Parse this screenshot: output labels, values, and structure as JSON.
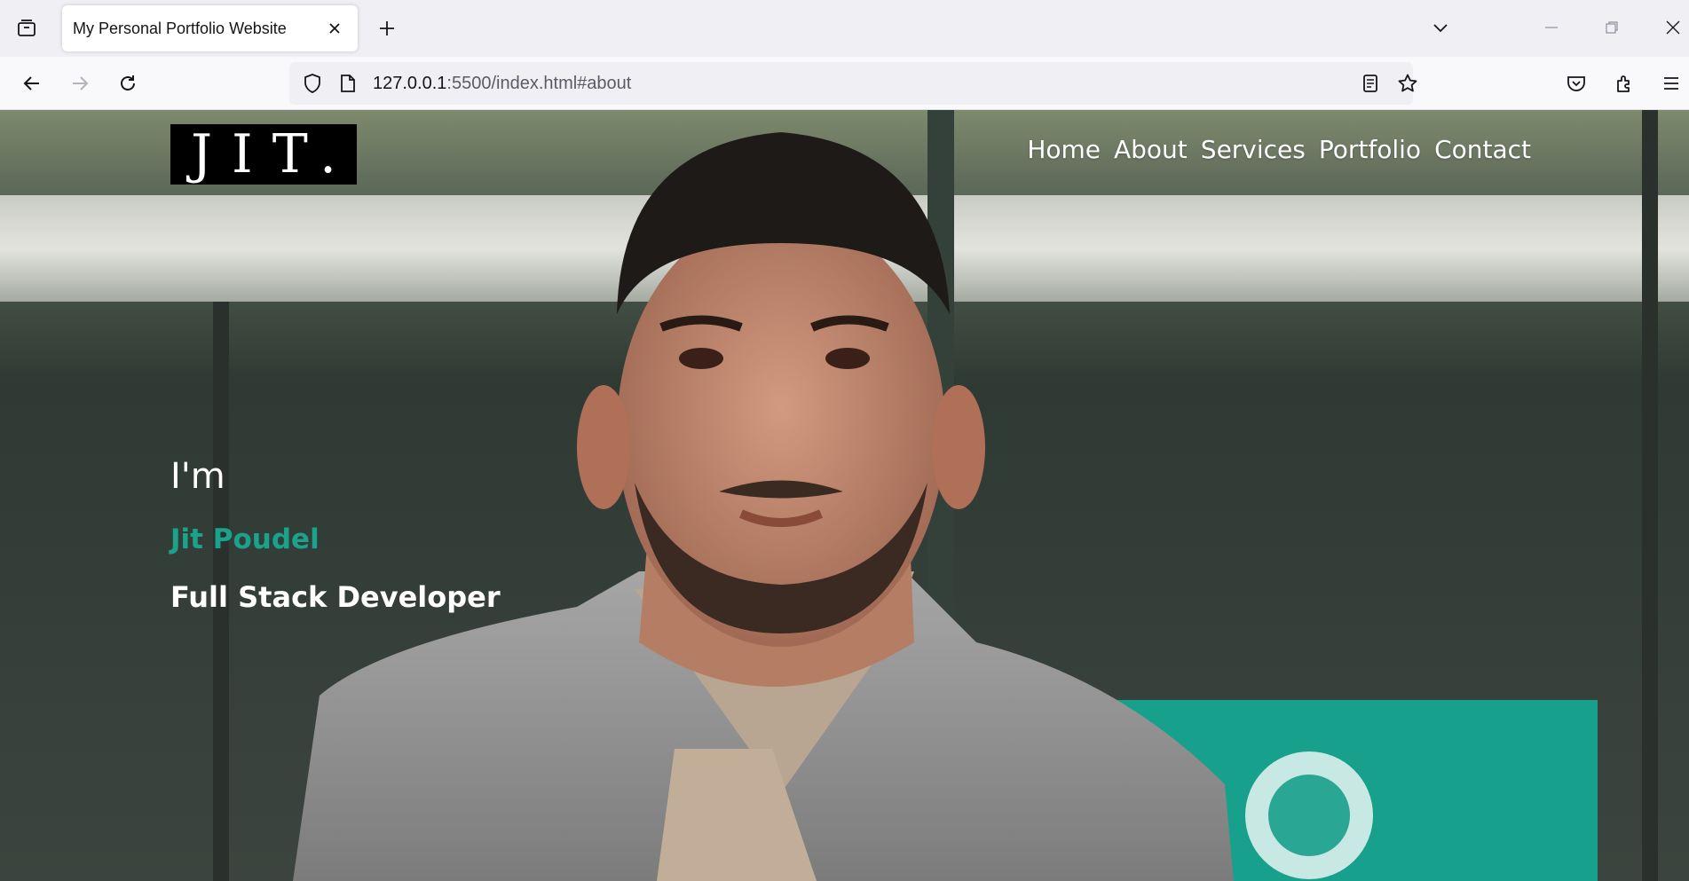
{
  "browser": {
    "tab_title": "My Personal Portfolio Website",
    "url_host": "127.0.0.1",
    "url_rest": ":5500/index.html#about"
  },
  "site": {
    "logo_text": "JIT.",
    "nav": [
      "Home",
      "About",
      "Services",
      "Portfolio",
      "Contact"
    ],
    "hero": {
      "intro": "I'm",
      "name": "Jit Poudel",
      "role": "Full Stack Developer"
    }
  },
  "colors": {
    "accent": "#1aa38a",
    "chrome_bg": "#f0f0f4",
    "logo_bg": "#000000"
  },
  "icons": [
    "tab-list-icon",
    "close-icon",
    "plus-icon",
    "chevron-down-icon",
    "minimize-icon",
    "restore-icon",
    "window-close-icon",
    "back-icon",
    "forward-icon",
    "reload-icon",
    "shield-icon",
    "page-icon",
    "reader-view-icon",
    "star-icon",
    "pocket-icon",
    "extensions-icon",
    "menu-icon"
  ]
}
